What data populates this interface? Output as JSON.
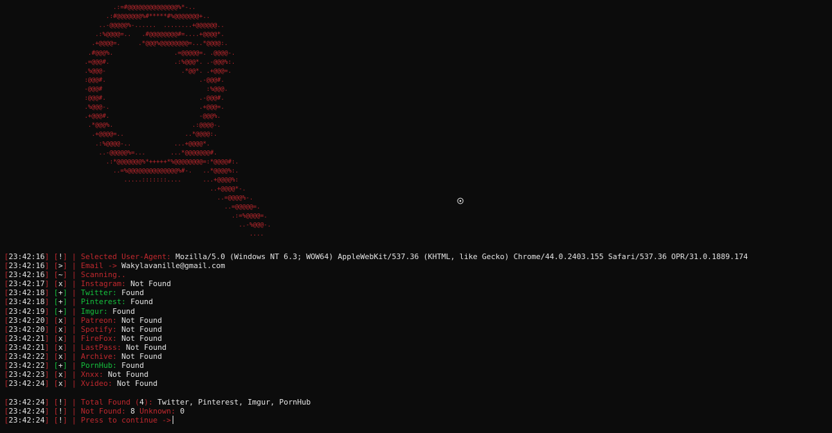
{
  "ascii_art": "                     ...:----:...\n                  .:=#@@@@@@@@@@@@@@%*-..\n                .:#@@@@@@@%#*****#%@@@@@@@+..\n              ..-@@@@@%-......  ........+@@@@@@..\n             .:%@@@@=..   .#@@@@@@@@#=....+@@@@*.\n            .+@@@@=.     .*@@@%@@@@@@@@=...*@@@@:.\n           .#@@@%.                 .=@@@@@=. .@@@@-.\n          .=@@@#.                  .:%@@@*. .-@@@%:.\n          .%@@@-                     .*@@*. .+@@@=.\n          :@@@#.                          .-@@@#.\n          -@@@#                             :%@@@.\n          :@@@#.                          .-@@@#.\n          .%@@@-.                         .+@@@=.\n          .+@@@#.                         -@@@%.\n           .*@@@%.                      .:@@@@-.\n            .+@@@@=..                 ..*@@@@:.\n             .:%@@@@-..            ...+@@@@*.\n              ..-@@@@@%=...       ...*@@@@@@@#.\n                .:*@@@@@@@%*+++++*%@@@@@@@@=:*@@@@#:.\n                  ..=%@@@@@@@@@@@@@@%#-.   ..*@@@@%:.\n                     .....:::::::....      ...+@@@@%:\n                                             ..+@@@@*-.\n                                               ..=@@@@%-.\n                                                 ..=@@@@@=.\n                                                   .:=%@@@@=.\n                                                     ..-%@@@-.\n                                                        ....",
  "log_lines": [
    {
      "time": "23:42:16",
      "sym": "!",
      "sym_color": "red",
      "label": "Selected User-Agent:",
      "label_color": "red",
      "value": "Mozilla/5.0 (Windows NT 6.3; WOW64) AppleWebKit/537.36 (KHTML, like Gecko) Chrome/44.0.2403.155 Safari/537.36 OPR/31.0.1889.174"
    },
    {
      "time": "23:42:16",
      "sym": ">",
      "sym_color": "red",
      "label": "Email ->",
      "label_color": "red",
      "value": "Wakylavanille@gmail.com"
    },
    {
      "time": "23:42:16",
      "sym": "~",
      "sym_color": "red",
      "label": "Scanning..",
      "label_color": "red",
      "value": ""
    },
    {
      "time": "23:42:17",
      "sym": "x",
      "sym_color": "red",
      "label": "Instagram:",
      "label_color": "red",
      "value": "Not Found"
    },
    {
      "time": "23:42:18",
      "sym": "+",
      "sym_color": "green",
      "label": "Twitter:",
      "label_color": "green",
      "value": "Found"
    },
    {
      "time": "23:42:18",
      "sym": "+",
      "sym_color": "green",
      "label": "Pinterest:",
      "label_color": "green",
      "value": "Found"
    },
    {
      "time": "23:42:19",
      "sym": "+",
      "sym_color": "green",
      "label": "Imgur:",
      "label_color": "green",
      "value": "Found"
    },
    {
      "time": "23:42:20",
      "sym": "x",
      "sym_color": "red",
      "label": "Patreon:",
      "label_color": "red",
      "value": "Not Found"
    },
    {
      "time": "23:42:20",
      "sym": "x",
      "sym_color": "red",
      "label": "Spotify:",
      "label_color": "red",
      "value": "Not Found"
    },
    {
      "time": "23:42:21",
      "sym": "x",
      "sym_color": "red",
      "label": "FireFox:",
      "label_color": "red",
      "value": "Not Found"
    },
    {
      "time": "23:42:21",
      "sym": "x",
      "sym_color": "red",
      "label": "LastPass:",
      "label_color": "red",
      "value": "Not Found"
    },
    {
      "time": "23:42:22",
      "sym": "x",
      "sym_color": "red",
      "label": "Archive:",
      "label_color": "red",
      "value": "Not Found"
    },
    {
      "time": "23:42:22",
      "sym": "+",
      "sym_color": "green",
      "label": "PornHub:",
      "label_color": "green",
      "value": "Found"
    },
    {
      "time": "23:42:23",
      "sym": "x",
      "sym_color": "red",
      "label": "Xnxx:",
      "label_color": "red",
      "value": "Not Found"
    },
    {
      "time": "23:42:24",
      "sym": "x",
      "sym_color": "red",
      "label": "Xvideo:",
      "label_color": "red",
      "value": "Not Found"
    }
  ],
  "summary": {
    "total": {
      "time": "23:42:24",
      "sym": "!",
      "label": "Total Found",
      "paren_open": "(",
      "count": "4",
      "paren_close": "):",
      "value": "Twitter, Pinterest, Imgur, PornHub"
    },
    "not_found": {
      "time": "23:42:24",
      "sym": "!",
      "label": "Not Found:",
      "count": "8",
      "unknown_label": "Unknown:",
      "unknown_count": "0"
    },
    "prompt": {
      "time": "23:42:24",
      "sym": "!",
      "label": "Press to continue ->"
    }
  },
  "colors": {
    "background": "#0c0c0c",
    "red": "#c0282e",
    "green": "#15c03d",
    "white": "#e5e5e5"
  },
  "icons": {
    "mouse_cursor": "crosshair-cursor-icon"
  }
}
